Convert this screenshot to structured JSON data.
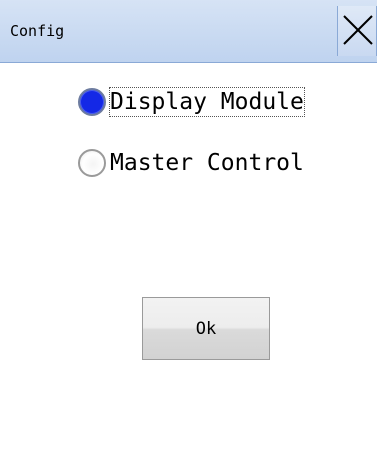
{
  "window": {
    "title": "Config",
    "close_icon": "close-icon"
  },
  "options": [
    {
      "label": "Display Module",
      "selected": true
    },
    {
      "label": "Master Control",
      "selected": false
    }
  ],
  "ok_button": {
    "label": "Ok"
  },
  "colors": {
    "titlebar": "#bfd3ef",
    "radio_selected": "#1428e6",
    "background": "#ffffff"
  }
}
